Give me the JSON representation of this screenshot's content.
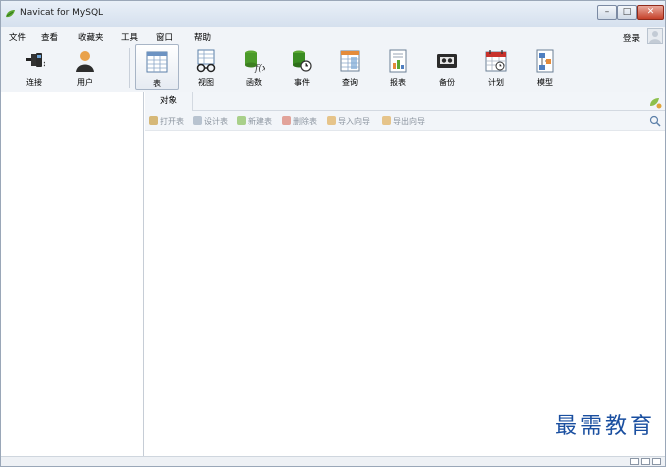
{
  "window": {
    "title": "Navicat for MySQL",
    "min": "–",
    "max": "□",
    "close": "✕"
  },
  "menu": [
    "文件",
    "查看",
    "收藏夹",
    "工具",
    "窗口",
    "帮助"
  ],
  "login": "登录",
  "toolbar": [
    {
      "label": "连接",
      "icon": "plug-icon"
    },
    {
      "label": "用户",
      "icon": "user-icon"
    },
    {
      "label": "表",
      "icon": "table-icon"
    },
    {
      "label": "视图",
      "icon": "view-glasses-icon"
    },
    {
      "label": "函数",
      "icon": "function-icon"
    },
    {
      "label": "事件",
      "icon": "event-clock-icon"
    },
    {
      "label": "查询",
      "icon": "query-icon"
    },
    {
      "label": "报表",
      "icon": "report-icon"
    },
    {
      "label": "备份",
      "icon": "backup-tape-icon"
    },
    {
      "label": "计划",
      "icon": "schedule-calendar-icon"
    },
    {
      "label": "模型",
      "icon": "model-icon"
    }
  ],
  "object_tab": "对象",
  "actions": [
    "打开表",
    "设计表",
    "新建表",
    "删除表",
    "导入向导",
    "导出向导"
  ],
  "watermark": "最需教育",
  "colors": {
    "accent": "#1a4fa0",
    "toolbar_bg": "#f1f4f8",
    "close_red": "#c5412a"
  }
}
